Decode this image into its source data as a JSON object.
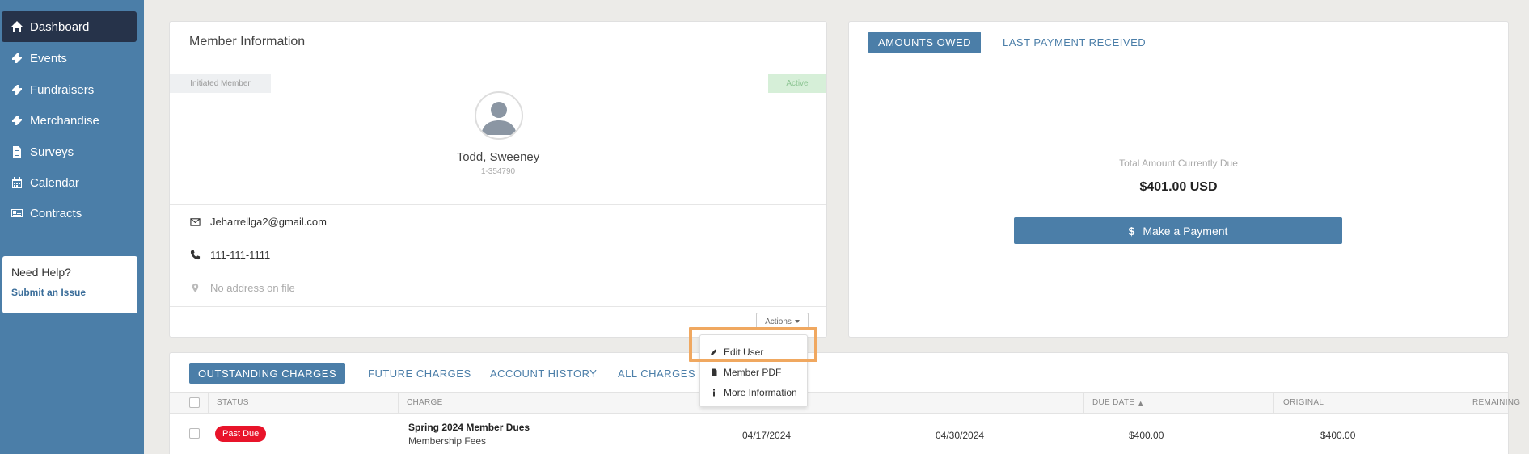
{
  "sidebar": {
    "items": [
      {
        "label": "Dashboard",
        "icon": "home-icon"
      },
      {
        "label": "Events",
        "icon": "ticket-icon"
      },
      {
        "label": "Fundraisers",
        "icon": "ticket-icon"
      },
      {
        "label": "Merchandise",
        "icon": "ticket-icon"
      },
      {
        "label": "Surveys",
        "icon": "document-icon"
      },
      {
        "label": "Calendar",
        "icon": "calendar-icon"
      },
      {
        "label": "Contracts",
        "icon": "id-card-icon"
      }
    ],
    "help": {
      "title": "Need Help?",
      "link": "Submit an Issue"
    }
  },
  "member": {
    "title": "Member Information",
    "status_tag": "Initiated Member",
    "active_tag": "Active",
    "name": "Todd, Sweeney",
    "id": "1-354790",
    "email": "Jeharrellga2@gmail.com",
    "phone": "111-111-1111",
    "address": "No address on file",
    "actions_label": "Actions"
  },
  "actions_menu": {
    "items": [
      "Edit User",
      "Member PDF",
      "More Information"
    ]
  },
  "amounts": {
    "tabs": [
      "AMOUNTS OWED",
      "LAST PAYMENT RECEIVED"
    ],
    "label": "Total Amount Currently Due",
    "value": "$401.00 USD",
    "pay_button": "Make a Payment",
    "pay_symbol": "$"
  },
  "charges": {
    "tabs": [
      "OUTSTANDING CHARGES",
      "FUTURE CHARGES",
      "ACCOUNT HISTORY",
      "ALL CHARGES"
    ],
    "columns": [
      "STATUS",
      "CHARGE",
      "DUE DATE",
      "ORIGINAL",
      "REMAINING"
    ],
    "sort_indicator": "▲",
    "rows": [
      {
        "status": "Past Due",
        "charge": "Spring 2024 Member Dues",
        "category": "Membership Fees",
        "date": "04/17/2024",
        "due_date": "04/30/2024",
        "original": "$400.00",
        "remaining": "$400.00"
      }
    ]
  },
  "colors": {
    "sidebar": "#4b7ea8",
    "sidebar_active": "#26334a",
    "accent": "#4b7ea8",
    "past_due": "#e8142a",
    "highlight": "#f0a860"
  }
}
